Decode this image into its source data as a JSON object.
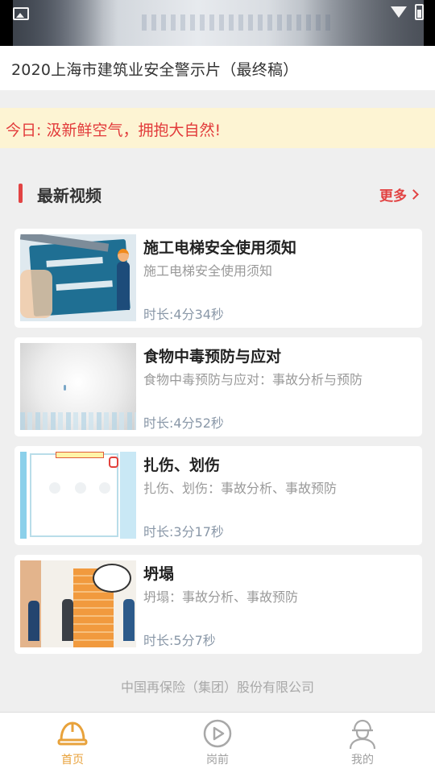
{
  "status_bar": {
    "image_icon": "image-icon",
    "wifi_icon": "wifi-icon",
    "battery_icon": "battery-icon"
  },
  "video": {
    "title": "2020上海市建筑业安全警示片（最终稿）"
  },
  "notice": {
    "text": "今日: 汲新鲜空气，拥抱大自然!"
  },
  "section": {
    "title": "最新视频",
    "more_label": "更多",
    "accent_color": "#e24343"
  },
  "videos": [
    {
      "title": "施工电梯安全使用须知",
      "desc": "施工电梯安全使用须知",
      "duration": "时长:4分34秒"
    },
    {
      "title": "食物中毒预防与应对",
      "desc": "食物中毒预防与应对：事故分析与预防",
      "duration": "时长:4分52秒"
    },
    {
      "title": "扎伤、划伤",
      "desc": "扎伤、划伤：事故分析、事故预防",
      "duration": "时长:3分17秒"
    },
    {
      "title": "坍塌",
      "desc": "坍塌：事故分析、事故预防",
      "duration": "时长:5分7秒"
    }
  ],
  "footer": {
    "company": "中国再保险（集团）股份有限公司"
  },
  "tabbar": {
    "active_color": "#e8a23b",
    "tabs": [
      {
        "label": "首页",
        "icon": "hard-hat-icon",
        "active": true
      },
      {
        "label": "岗前",
        "icon": "play-circle-icon",
        "active": false
      },
      {
        "label": "我的",
        "icon": "worker-profile-icon",
        "active": false
      }
    ]
  }
}
